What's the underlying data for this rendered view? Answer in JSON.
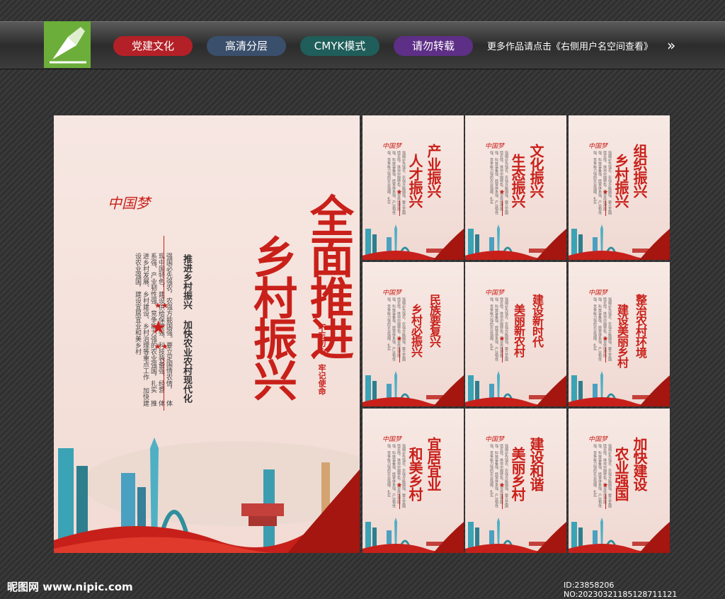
{
  "header": {
    "tags": [
      {
        "label": "党建文化",
        "color": "#b42027"
      },
      {
        "label": "高清分层",
        "color": "#3a4f6c"
      },
      {
        "label": "CMYK模式",
        "color": "#1f5e5a"
      },
      {
        "label": "请勿转载",
        "color": "#5e2f86"
      }
    ],
    "note": "更多作品请点击《右侧用户名空间查看》",
    "arrow": "»"
  },
  "main": {
    "brand": "中国梦",
    "title_col1": "全面推进",
    "title_col2": "乡村振兴",
    "slogan": "推进乡村振兴 加快农业农村现代化",
    "body_lines": [
      "强国必先强农，农强方能国强。要立足国情农情，",
      "体现中国特色，建设供给保障强、科技装备强、经营",
      "体系强、产业韧性强、竞争能力强的农业强国，扎实",
      "推进乡村发展、乡村建设、乡村治理等重点工作",
      "加快建设农业强国，建设宜居宜业和美乡村"
    ],
    "motto": "不忘初心 牢记使命"
  },
  "panels": [
    {
      "col1": "产业振兴",
      "col2": "人才振兴"
    },
    {
      "col1": "文化振兴",
      "col2": "生态振兴"
    },
    {
      "col1": "组织振兴",
      "col2": "乡村振兴"
    },
    {
      "col1": "民族要复兴",
      "col2": "乡村必振兴"
    },
    {
      "col1": "建设新时代",
      "col2": "美丽新农村"
    },
    {
      "col1": "整治农村环境",
      "col2": "建设美丽乡村"
    },
    {
      "col1": "宜居宜业",
      "col2": "和美乡村"
    },
    {
      "col1": "建设和谐",
      "col2": "美丽乡村"
    },
    {
      "col1": "加快建设",
      "col2": "农业强国"
    }
  ],
  "footer": {
    "site": "昵图网 www.nipic.com",
    "id": "ID:23858206 NO:20230321185128711121"
  }
}
